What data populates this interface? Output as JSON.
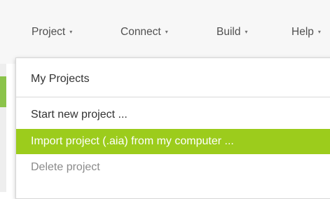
{
  "menubar": {
    "items": [
      {
        "label": "Project",
        "caret": "▾"
      },
      {
        "label": "Connect",
        "caret": "▾"
      },
      {
        "label": "Build",
        "caret": "▾"
      },
      {
        "label": "Help",
        "caret": "▾"
      }
    ]
  },
  "project_menu": {
    "items": [
      {
        "label": "My Projects",
        "state": "normal"
      },
      {
        "label": "Start new project ...",
        "state": "normal"
      },
      {
        "label": "Import project (.aia) from my computer ...",
        "state": "highlighted"
      },
      {
        "label": "Delete project",
        "state": "disabled"
      }
    ]
  },
  "colors": {
    "highlight": "#9ccc1c",
    "side_accent": "#8bc34a",
    "topbar_bg": "#f7f7f7"
  }
}
